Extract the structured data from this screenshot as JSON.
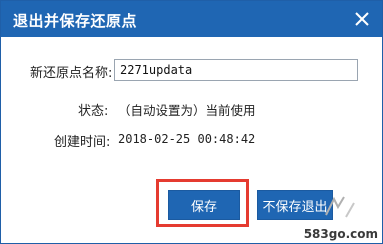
{
  "dialog": {
    "title": "退出并保存还原点",
    "close_icon": "close-icon"
  },
  "form": {
    "name_label": "新还原点名称:",
    "name_value": "2271updata",
    "status_label": "状态:",
    "status_value": "（自动设置为）当前使用",
    "created_label": "创建时间:",
    "created_value": "2018-02-25 00:48:42"
  },
  "buttons": {
    "save": "保存",
    "no_save_exit": "不保存退出"
  },
  "watermark": {
    "site": "583go.com"
  },
  "colors": {
    "titlebar": "#1f66b3",
    "button": "#1f66b3",
    "highlight": "#e53b30"
  }
}
